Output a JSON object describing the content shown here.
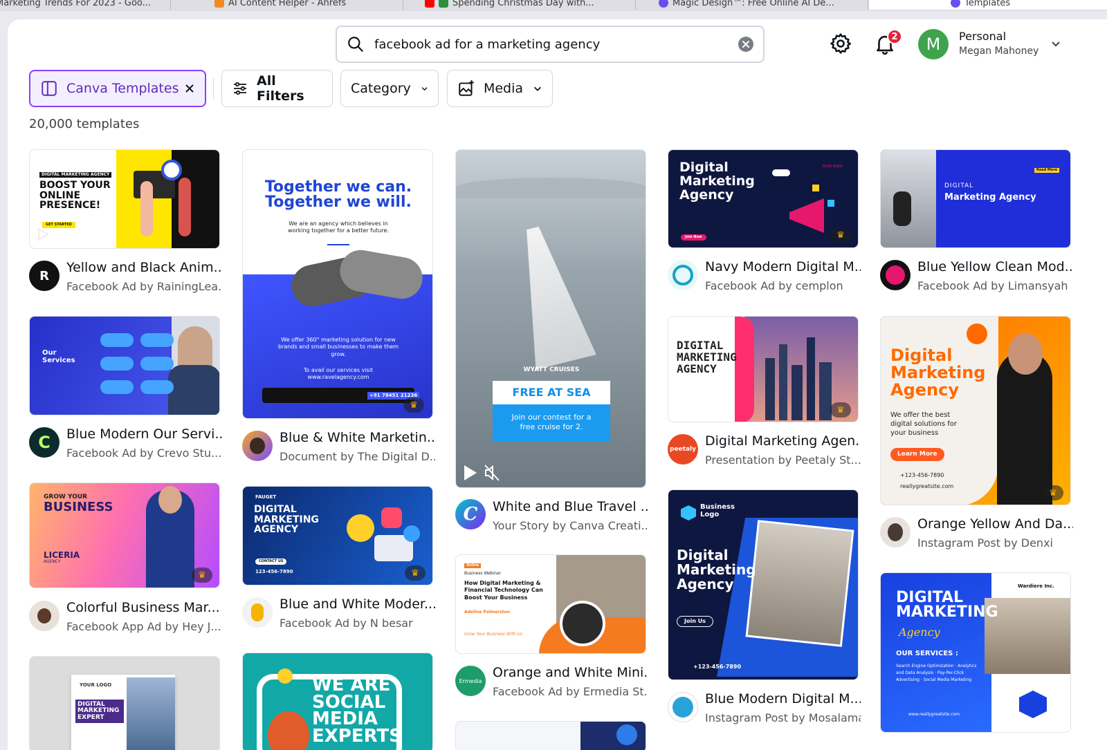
{
  "browser_tabs": [
    {
      "label": "Marketing Trends For 2023 - Goo..."
    },
    {
      "label": "AI Content Helper - Ahrefs"
    },
    {
      "label": "Spending Christmas Day with..."
    },
    {
      "label": "Magic Design™: Free Online AI De..."
    },
    {
      "label": "Templates"
    }
  ],
  "search": {
    "value": "facebook ad for a marketing agency",
    "placeholder": "Search templates"
  },
  "notifications": {
    "count": "2"
  },
  "account": {
    "initial": "M",
    "name": "Personal",
    "user": "Megan Mahoney"
  },
  "filters": {
    "selected": "Canva Templates",
    "all_filters": "All Filters",
    "category": "Category",
    "media": "Media"
  },
  "results_count": "20,000 templates",
  "thumb_text": {
    "c1_badge": "DIGITAL MARKETING AGENCY",
    "c1_head": "BOOST YOUR ONLINE PRESENCE!",
    "c1_btn": "GET STARTED",
    "c2_head": "Our Services",
    "c3_top": "GROW YOUR",
    "c3_head": "BUSINESS",
    "c3_brand": "LICERIA",
    "c3_brand_sub": "AGENCY",
    "c5_h1": "Together we can.",
    "c5_h2": "Together we will.",
    "c5_sub": "We are an agency which believes in working together for a better future.",
    "c5_mid": "We offer 360° marketing solution for new brands and small businesses to make them grow.",
    "c5_low": "To avail our services visit www.ravelagency.com",
    "c5_phone": "+91 78451 21236",
    "c6_brand": "FAUGET",
    "c6_head": "DIGITAL MARKETING AGENCY",
    "c6_btn": "CONTACT US",
    "c6_phone": "123-456-7890",
    "c7_head": "WE ARE SOCIAL MEDIA EXPERTS",
    "c8_brand": "WYATT CRUISES",
    "c8_head": "FREE AT SEA",
    "c8_sub": "Join our contest for a free cruise for 2.",
    "c9_tag": "Online",
    "c9_kicker": "Business Webinar",
    "c9_head": "How Digital Marketing & Financial Technology Can Boost Your Business",
    "c9_name": "Adeline Palmerston",
    "c9_sub": "Grow Your Business With Us",
    "c11_head": "Digital Marketing Agency",
    "c11_btn": "Join Now",
    "c11_logo": "YOUR LOGO",
    "c12_head": "DIGITAL MARKETING AGENCY",
    "c13_brand": "Business Logo",
    "c13_head": "Digital Marketing Agency",
    "c13_btn": "Join Us",
    "c13_phone": "+123-456-7890",
    "c14_small": "DIGITAL",
    "c14_head": "Marketing Agency",
    "c14_btn": "Read More",
    "c15_head": "Digital Marketing Agency",
    "c15_sub": "We offer the best digital solutions for your business",
    "c15_btn": "Learn More",
    "c15_phone": "+123-456-7890",
    "c15_site": "reallygreatsite.com",
    "c16_brand": "Wardiere Inc.",
    "c16_head": "DIGITAL MARKETING",
    "c16_script": "Agency",
    "c16_sub": "OUR SERVICES :",
    "c16_items": "Search Engine Optimization · Analytics and Data Analysis · Pay-Per-Click Advertising · Social Media Marketing",
    "c16_site": "www.reallygreatsite.com",
    "c4_logo": "YOUR LOGO",
    "c4_head": "DIGITAL MARKETING EXPERT"
  },
  "cards": {
    "c1": {
      "title": "Yellow and Black Anim...",
      "sub": "Facebook Ad by RainingLea..."
    },
    "c2": {
      "title": "Blue Modern Our Servi...",
      "sub": "Facebook Ad by Crevo Stu..."
    },
    "c3": {
      "title": "Colorful Business Mar...",
      "sub": "Facebook App Ad by Hey J..."
    },
    "c5": {
      "title": "Blue & White Marketin...",
      "sub": "Document by The Digital D..."
    },
    "c6": {
      "title": "Blue and White Moder...",
      "sub": "Facebook Ad by N besar"
    },
    "c8": {
      "title": "White and Blue Travel ...",
      "sub": "Your Story by Canva Creati..."
    },
    "c9": {
      "title": "Orange and White Mini...",
      "sub": "Facebook Ad by Ermedia St..."
    },
    "c11": {
      "title": "Navy Modern Digital M...",
      "sub": "Facebook Ad by cemplon"
    },
    "c12": {
      "title": "Digital Marketing Agen...",
      "sub": "Presentation by Peetaly St..."
    },
    "c13": {
      "title": "Blue Modern Digital M...",
      "sub": "Instagram Post by Mosalama"
    },
    "c14": {
      "title": "Blue Yellow Clean Mod...",
      "sub": "Facebook Ad by Limansyah"
    },
    "c15": {
      "title": "Orange Yellow And Da...",
      "sub": "Instagram Post by Denxi"
    }
  },
  "icons": {
    "search": "search-icon",
    "clear": "close-circle-icon",
    "settings": "gear-icon",
    "notifications": "bell-icon",
    "chevron": "chevron-down-icon",
    "filters": "sliders-icon",
    "media": "image-plus-icon",
    "templates": "layout-icon",
    "premium": "crown-icon",
    "play": "play-icon",
    "mute": "mute-icon"
  },
  "colors": {
    "accent": "#8b3dff",
    "badge": "#e5243b",
    "avatar": "#3fa34d"
  }
}
